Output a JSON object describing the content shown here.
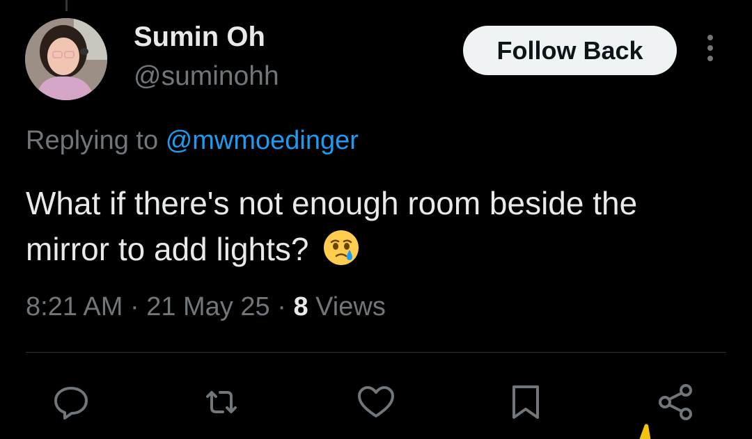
{
  "tweet": {
    "author_name": "Sumin Oh",
    "author_handle": "@suminohh",
    "follow_label": "Follow Back",
    "reply_prefix": "Replying to",
    "reply_to": "@mwmoedinger",
    "text": "What if there's not enough room beside the mirror to add lights?",
    "emoji": "face-holding-back-tears",
    "time": "8:21 AM",
    "separator": "·",
    "date": "21 May 25",
    "views_count": "8",
    "views_label": "Views"
  },
  "actions": [
    {
      "name": "reply",
      "icon": "speech-bubble-icon"
    },
    {
      "name": "retweet",
      "icon": "retweet-icon"
    },
    {
      "name": "like",
      "icon": "heart-icon"
    },
    {
      "name": "bookmark",
      "icon": "bookmark-icon"
    },
    {
      "name": "share",
      "icon": "share-icon"
    }
  ],
  "colors": {
    "background": "#000000",
    "primary_text": "#e7e9ea",
    "secondary_text": "#71767b",
    "link": "#1d9bf0",
    "button_bg": "#eff3f4",
    "button_text": "#0f1419",
    "divider": "#2f3336"
  }
}
